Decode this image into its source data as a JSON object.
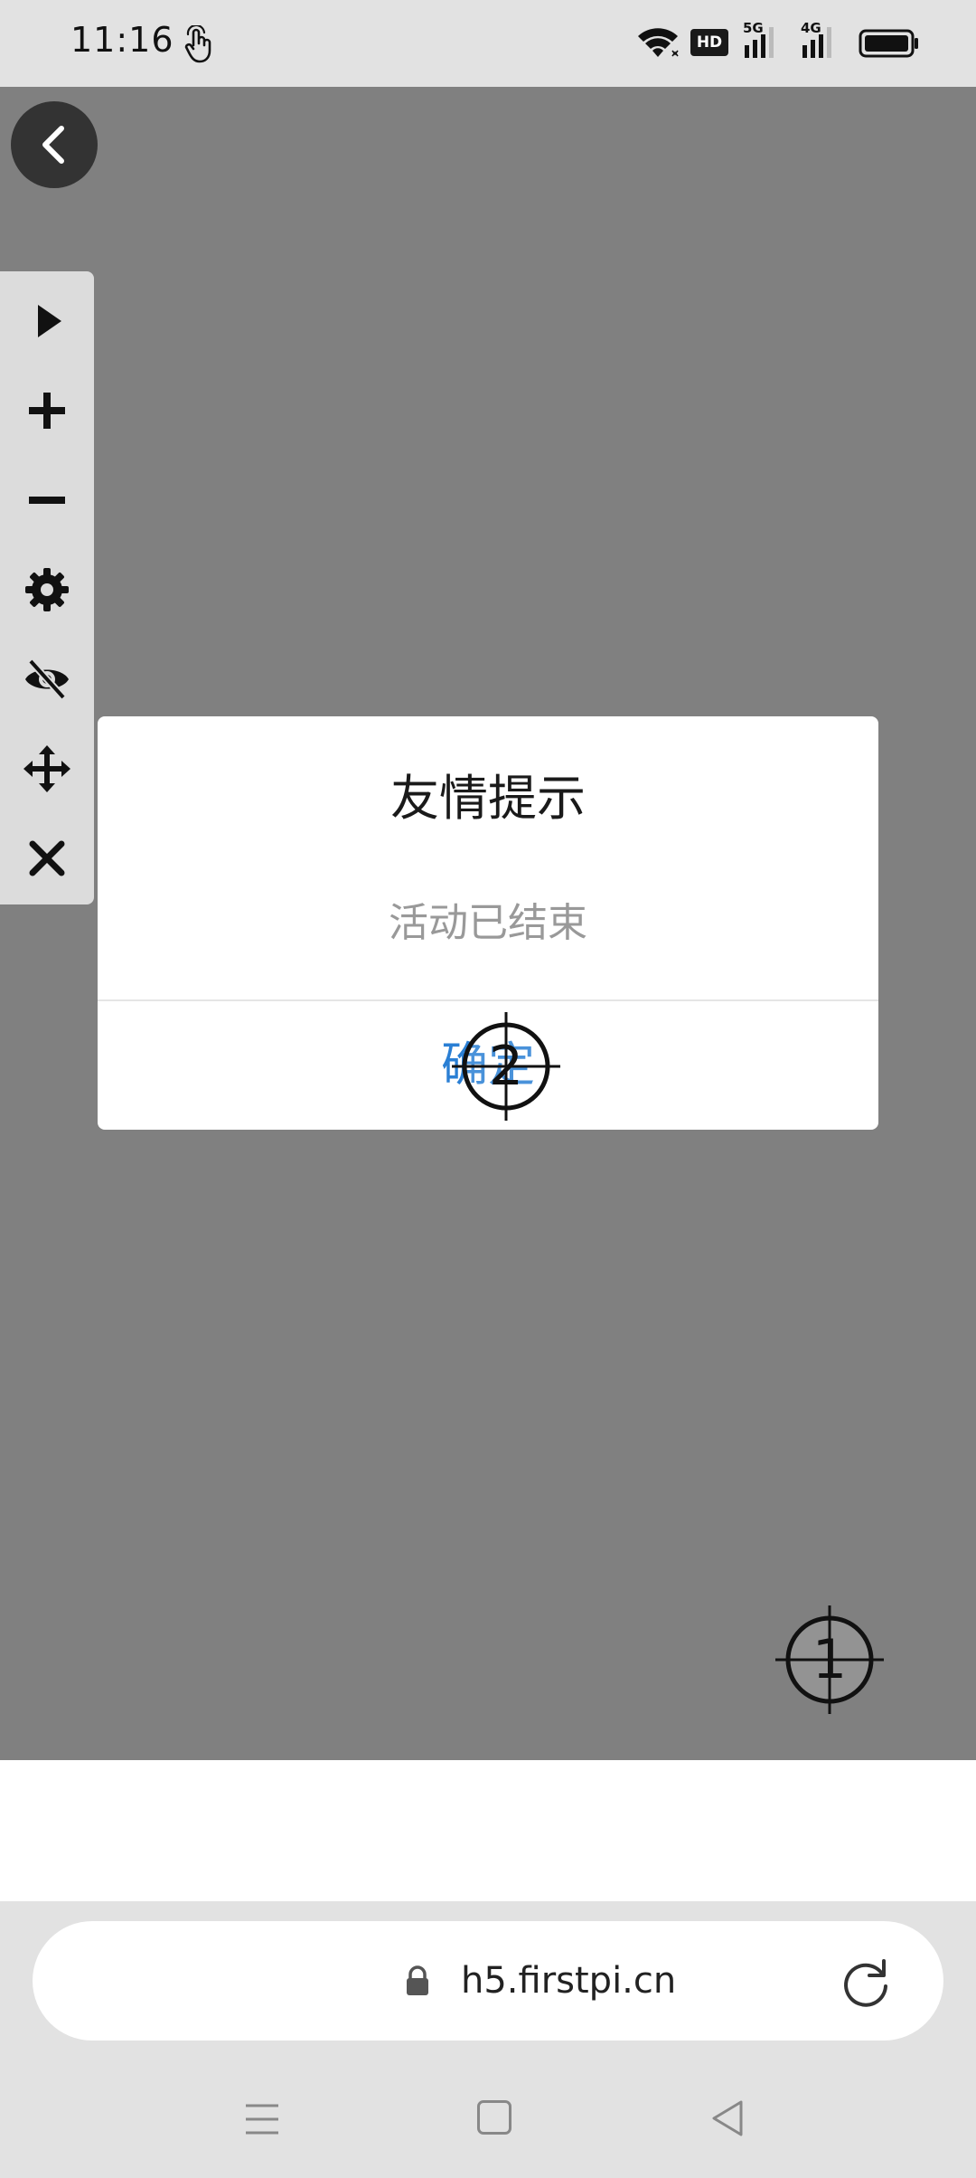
{
  "status_bar": {
    "time": "11:16",
    "hd_label": "HD",
    "net1_label": "5G",
    "net2_label": "4G"
  },
  "toolbar": {
    "items": [
      "play-icon",
      "plus-icon",
      "minus-icon",
      "gear-icon",
      "eye-off-icon",
      "move-icon",
      "close-icon"
    ]
  },
  "dialog": {
    "title": "友情提示",
    "message": "活动已结束",
    "confirm_label": "确定"
  },
  "markers": {
    "marker1": "1",
    "marker2": "2"
  },
  "browser": {
    "url": "h5.firstpi.cn"
  },
  "colors": {
    "overlay": "#808080",
    "confirm_text": "#2a7fd4",
    "dialog_bg": "#ffffff"
  }
}
